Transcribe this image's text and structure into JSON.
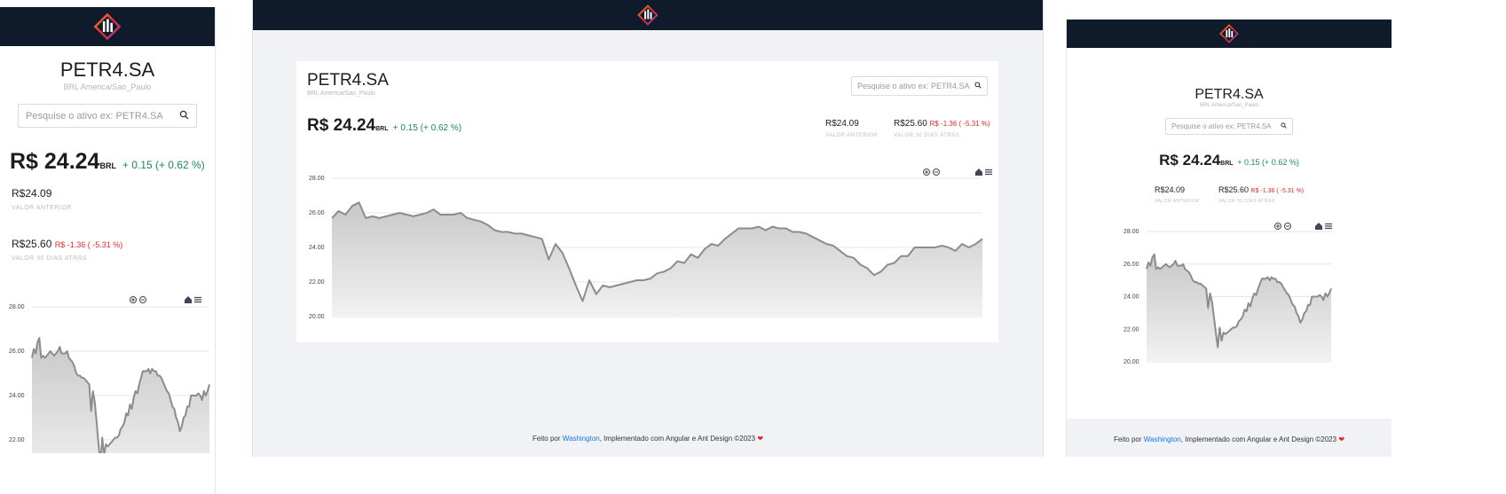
{
  "brand": {
    "logo_icon": "candlestick-diamond-logo",
    "nav_color": "#0f1a2a"
  },
  "asset": {
    "ticker": "PETR4.SA",
    "subtitle": "BRL America/Sao_Paulo"
  },
  "search": {
    "placeholder": "Pesquise o ativo ex: PETR4.SA",
    "icon": "search-icon"
  },
  "quote": {
    "price": "R$ 24.24",
    "currency": "BRL",
    "change": "+ 0.15 (+ 0.62 %)"
  },
  "stats": {
    "previous_value": "R$24.09",
    "previous_label": "VALOR ANTERIOR",
    "d30_value": "R$25.60",
    "d30_change": "R$ -1.36 ( -5.31 %)",
    "d30_label": "VALOR 30 DIAS ATRÁS"
  },
  "chart_toolbar": {
    "zoom_in": "zoom-in-icon",
    "zoom_out": "zoom-out-icon",
    "home": "home-icon",
    "menu": "menu-icon"
  },
  "chart_data": {
    "type": "area",
    "yticks": [
      "28.00",
      "26.00",
      "24.00",
      "22.00",
      "20.00"
    ],
    "ylim": [
      20,
      28
    ],
    "series": [
      {
        "values": [
          25.7,
          26.1,
          25.9,
          26.4,
          26.6,
          25.7,
          25.8,
          25.7,
          25.8,
          25.9,
          26.0,
          25.9,
          25.8,
          25.9,
          26.0,
          26.2,
          25.9,
          25.9,
          25.9,
          26.0,
          25.7,
          25.6,
          25.5,
          25.3,
          25.0,
          24.9,
          24.9,
          24.8,
          24.8,
          24.7,
          24.6,
          24.5,
          23.3,
          24.2,
          23.7,
          22.8,
          21.8,
          20.9,
          22.1,
          21.3,
          21.8,
          21.7,
          21.8,
          21.9,
          22.0,
          22.1,
          22.1,
          22.2,
          22.5,
          22.6,
          22.8,
          23.2,
          23.1,
          23.6,
          23.4,
          23.9,
          24.2,
          24.1,
          24.5,
          24.8,
          25.1,
          25.1,
          25.1,
          25.2,
          25.0,
          25.2,
          25.1,
          25.1,
          24.9,
          24.9,
          24.8,
          24.6,
          24.4,
          24.2,
          24.1,
          23.8,
          23.5,
          23.4,
          23.0,
          22.8,
          22.4,
          22.6,
          23.0,
          23.1,
          23.5,
          23.5,
          24.0,
          24.0,
          24.0,
          24.0,
          24.1,
          24.0,
          23.8,
          24.2,
          24.0,
          24.2,
          24.5
        ]
      }
    ]
  },
  "footer": {
    "prefix": "Feito por",
    "author": "Washington",
    "suffix": ", Implementado com Angular e Ant Design ©2023",
    "heart": "❤"
  }
}
